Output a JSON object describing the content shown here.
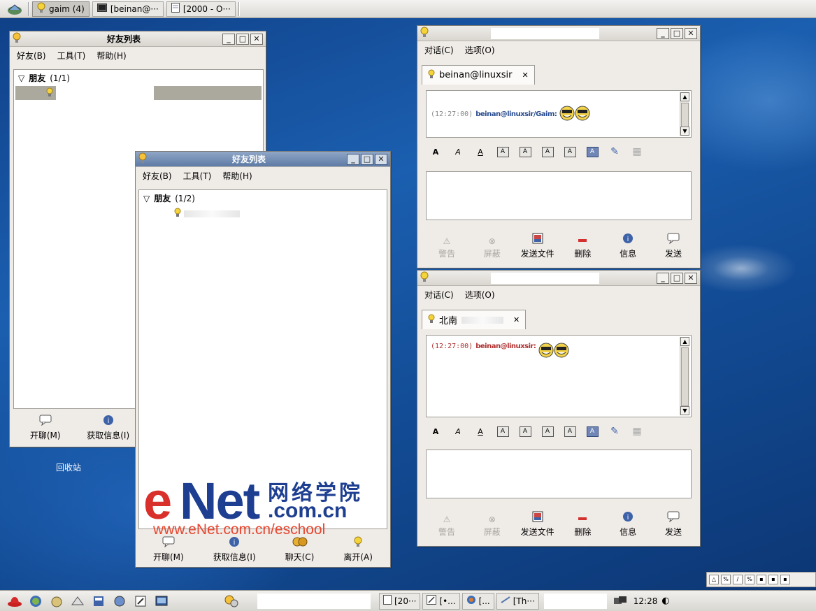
{
  "top_panel": {
    "tasks": [
      {
        "label": "gaim (4)",
        "icon": "bulb-icon",
        "active": true
      },
      {
        "label": "[beinan@···",
        "icon": "terminal-icon",
        "active": false
      },
      {
        "label": "[2000 - O···",
        "icon": "document-icon",
        "active": false
      }
    ]
  },
  "buddy1": {
    "title": "好友列表",
    "menu": [
      "好友(B)",
      "工具(T)",
      "帮助(H)"
    ],
    "group_name": "朋友",
    "group_count": "(1/1)",
    "buttons": [
      {
        "label": "开聊(M)",
        "icon": "chat-icon"
      },
      {
        "label": "获取信息(I)",
        "icon": "info-icon"
      }
    ]
  },
  "buddy2": {
    "title": "好友列表",
    "menu": [
      "好友(B)",
      "工具(T)",
      "帮助(H)"
    ],
    "group_name": "朋友",
    "group_count": "(1/2)",
    "buttons": [
      {
        "label": "开聊(M)",
        "icon": "chat-icon"
      },
      {
        "label": "获取信息(I)",
        "icon": "info-icon"
      },
      {
        "label": "聊天(C)",
        "icon": "group-chat-icon"
      },
      {
        "label": "离开(A)",
        "icon": "away-icon"
      }
    ]
  },
  "conv1": {
    "menu": [
      "对话(C)",
      "选项(O)"
    ],
    "tab_label": "beinan@linuxsir",
    "log_time": "(12:27:00)",
    "log_name": "beinan@linuxsir/Gaim:",
    "buttons": [
      {
        "label": "警告",
        "icon": "warn-icon",
        "disabled": true
      },
      {
        "label": "屏蔽",
        "icon": "block-icon",
        "disabled": true
      },
      {
        "label": "发送文件",
        "icon": "send-file-icon",
        "disabled": false
      },
      {
        "label": "删除",
        "icon": "remove-icon",
        "disabled": false
      },
      {
        "label": "信息",
        "icon": "info-icon",
        "disabled": false
      },
      {
        "label": "发送",
        "icon": "send-icon",
        "disabled": false
      }
    ]
  },
  "conv2": {
    "menu": [
      "对话(C)",
      "选项(O)"
    ],
    "tab_label": "北南",
    "log_time": "(12:27:00)",
    "log_name": "beinan@linuxsir:",
    "buttons": [
      {
        "label": "警告",
        "icon": "warn-icon",
        "disabled": true
      },
      {
        "label": "屏蔽",
        "icon": "block-icon",
        "disabled": true
      },
      {
        "label": "发送文件",
        "icon": "send-file-icon",
        "disabled": false
      },
      {
        "label": "删除",
        "icon": "remove-icon",
        "disabled": false
      },
      {
        "label": "信息",
        "icon": "info-icon",
        "disabled": false
      },
      {
        "label": "发送",
        "icon": "send-icon",
        "disabled": false
      }
    ]
  },
  "format_bar": [
    {
      "glyph": "A",
      "name": "bold-icon"
    },
    {
      "glyph": "A",
      "name": "italic-icon"
    },
    {
      "glyph": "A",
      "name": "underline-icon"
    },
    {
      "glyph": "A",
      "name": "font-larger-icon"
    },
    {
      "glyph": "A",
      "name": "font-smaller-icon"
    },
    {
      "glyph": "A",
      "name": "font-face-icon"
    },
    {
      "glyph": "A",
      "name": "foreground-color-icon"
    },
    {
      "glyph": "A",
      "name": "background-color-icon"
    },
    {
      "glyph": "✎",
      "name": "insert-link-icon"
    },
    {
      "glyph": "▦",
      "name": "insert-image-icon"
    }
  ],
  "desktop": {
    "trash_label": "回收站"
  },
  "watermark": {
    "e": "e",
    "net": "Net",
    "cn_text": "网络学院",
    "domain": ".com.cn",
    "url": "www.eNet.com.cn/eschool"
  },
  "bottom_panel": {
    "tasks": [
      {
        "label": "[20···",
        "icon": "document-icon"
      },
      {
        "label": "[•...",
        "icon": "edit-icon"
      },
      {
        "label": "[...",
        "icon": "browser-icon"
      },
      {
        "label": "[Th···",
        "icon": "mail-icon"
      }
    ],
    "clock": "12:28"
  },
  "colors": {
    "watermark_red": "#d9302b",
    "watermark_blue": "#1e3f91",
    "desktop_blue": "#1b5fb0"
  }
}
